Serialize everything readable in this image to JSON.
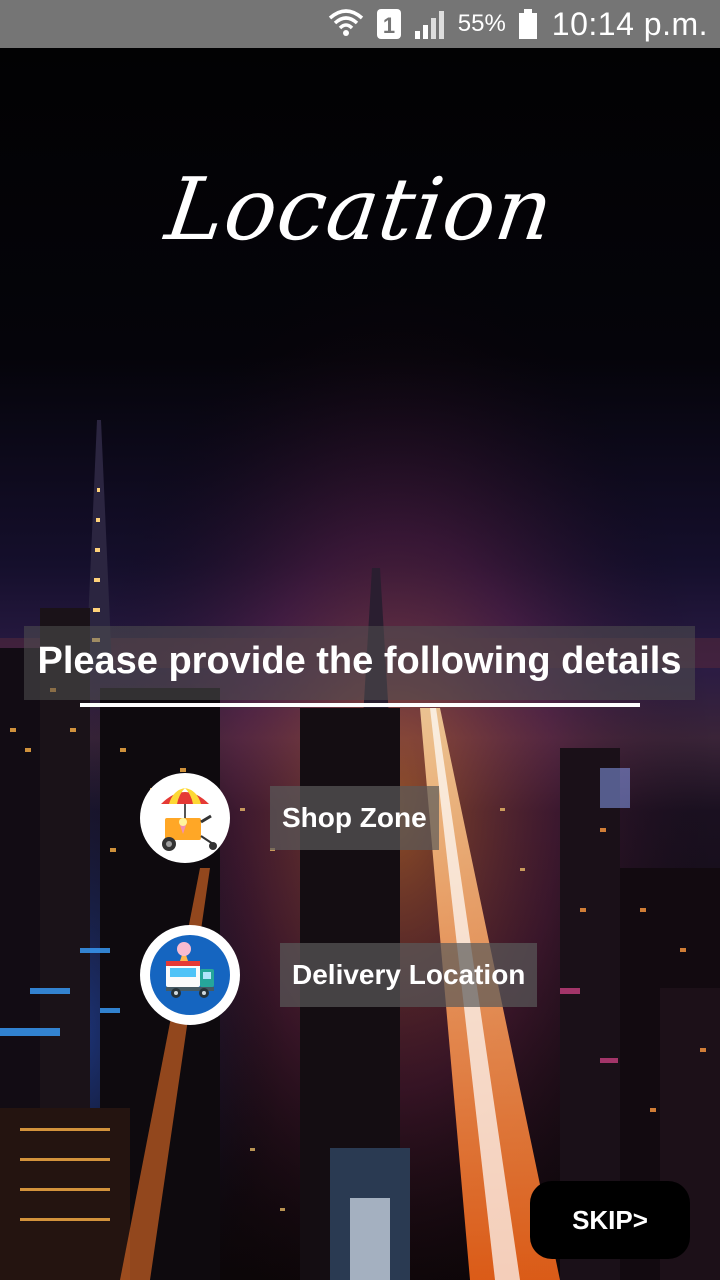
{
  "status_bar": {
    "sim_slot": "1",
    "battery_percent": "55%",
    "time": "10:14 p.m."
  },
  "page": {
    "title": "Location",
    "heading": "Please provide the following details"
  },
  "options": {
    "shop_zone": {
      "label": "Shop Zone",
      "icon": "ice-cream-cart-icon"
    },
    "delivery_location": {
      "label": "Delivery Location",
      "icon": "food-truck-icon"
    }
  },
  "actions": {
    "skip_label": "SKIP>"
  },
  "colors": {
    "status_bar_bg": "#757575",
    "banner_bg": "#505050",
    "skip_bg": "#000000",
    "delivery_icon_ring": "#1565c0"
  }
}
